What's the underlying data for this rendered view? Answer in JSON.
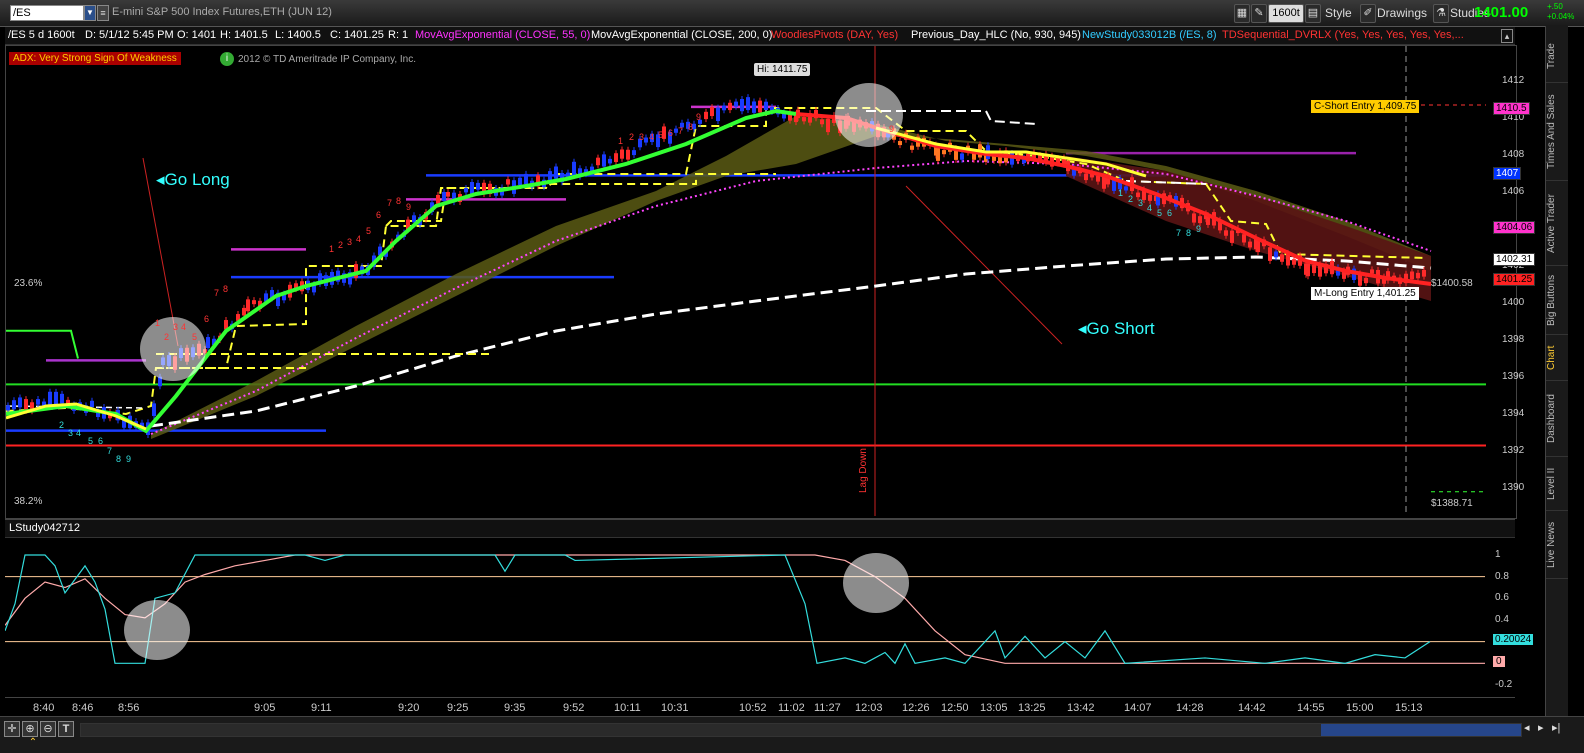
{
  "header": {
    "symbol": "/ES",
    "description": "E-mini S&P 500 Index Futures,ETH (JUN 12)",
    "aggregation": "1600t",
    "style_label": "Style",
    "drawings_label": "Drawings",
    "studies_label": "Studies",
    "last_price": "1401.00",
    "change_abs": "+.50",
    "change_pct": "+0.04%"
  },
  "infobar": {
    "period": "/ES 5 d 1600t",
    "date": "D: 5/1/12 5:45 PM",
    "open": "O: 1401",
    "high": "H: 1401.5",
    "low": "L: 1400.5",
    "close": "C: 1401.25",
    "range": "R: 1",
    "study1": "MovAvgExponential (CLOSE, 55, 0)",
    "study2": "MovAvgExponential (CLOSE, 200, 0)",
    "study3": "WoodiesPivots (DAY, Yes)",
    "study4": "Previous_Day_HLC (No, 930, 945)",
    "study5": "NewStudy033012B (/ES, 8)",
    "study6": "TDSequential_DVRLX (Yes, Yes, Yes, Yes, Yes,..."
  },
  "alert": {
    "text": "ADX: Very Strong Sign Of Weakness",
    "copyright": "2012 © TD Ameritrade IP Company, Inc."
  },
  "annotations": {
    "go_long": "Go Long",
    "go_short": "Go Short",
    "high_label": "Hi: 1411.75",
    "lag_down": "Lag Down",
    "fib_top": "23.6%",
    "fib_bottom": "38.2%",
    "c_short_entry": "C-Short Entry 1,409.75",
    "m_long_entry": "M-Long Entry 1,401.25",
    "price_bubble": "$1400.58",
    "price_bottom": "$1388.71"
  },
  "price_axis": {
    "ticks": [
      "1412",
      "1410",
      "1408",
      "1406",
      "1404",
      "1402",
      "1400",
      "1398",
      "1396",
      "1394",
      "1392",
      "1390"
    ],
    "badges": [
      {
        "label": "1410.5",
        "color": "#ff33cc",
        "text_color": "#000"
      },
      {
        "label": "1407",
        "color": "#0033ff",
        "text_color": "#fff"
      },
      {
        "label": "1404.06",
        "color": "#ff33cc",
        "text_color": "#000"
      },
      {
        "label": "1402.31",
        "color": "#ffffff",
        "text_color": "#000"
      },
      {
        "label": "1401.25",
        "color": "#ff2222",
        "text_color": "#000"
      }
    ]
  },
  "lower_study": {
    "name": "LStudy042712",
    "ticks": [
      "1",
      "0.8",
      "0.6",
      "0.4",
      "0.2",
      "0",
      "-0.2"
    ],
    "badge_cyan": "0.20024",
    "badge_pink": "0"
  },
  "time_axis": [
    "8:40",
    "8:46",
    "8:56",
    "9:05",
    "9:11",
    "9:20",
    "9:25",
    "9:35",
    "9:52",
    "10:11",
    "10:31",
    "10:52",
    "11:02",
    "11:27",
    "12:03",
    "12:26",
    "12:50",
    "13:05",
    "13:25",
    "13:42",
    "14:07",
    "14:28",
    "14:42",
    "14:55",
    "15:00",
    "15:13"
  ],
  "sidebar_tabs": [
    "Trade",
    "Times And Sales",
    "Active Trader",
    "Big Buttons",
    "Chart",
    "Dashboard",
    "Level II",
    "Live News"
  ],
  "colors": {
    "bull": "#1a3cff",
    "bear": "#ff2a2a",
    "ema_fast_up": "#33ff33",
    "ema_fast_down": "#ff2222",
    "ema_slow": "#ffffff",
    "support": "#22dd22",
    "resistance": "#ff2222",
    "pivot": "#ffff33",
    "study_cyan": "#33dddd",
    "study_pink": "#ffaaaa"
  }
}
